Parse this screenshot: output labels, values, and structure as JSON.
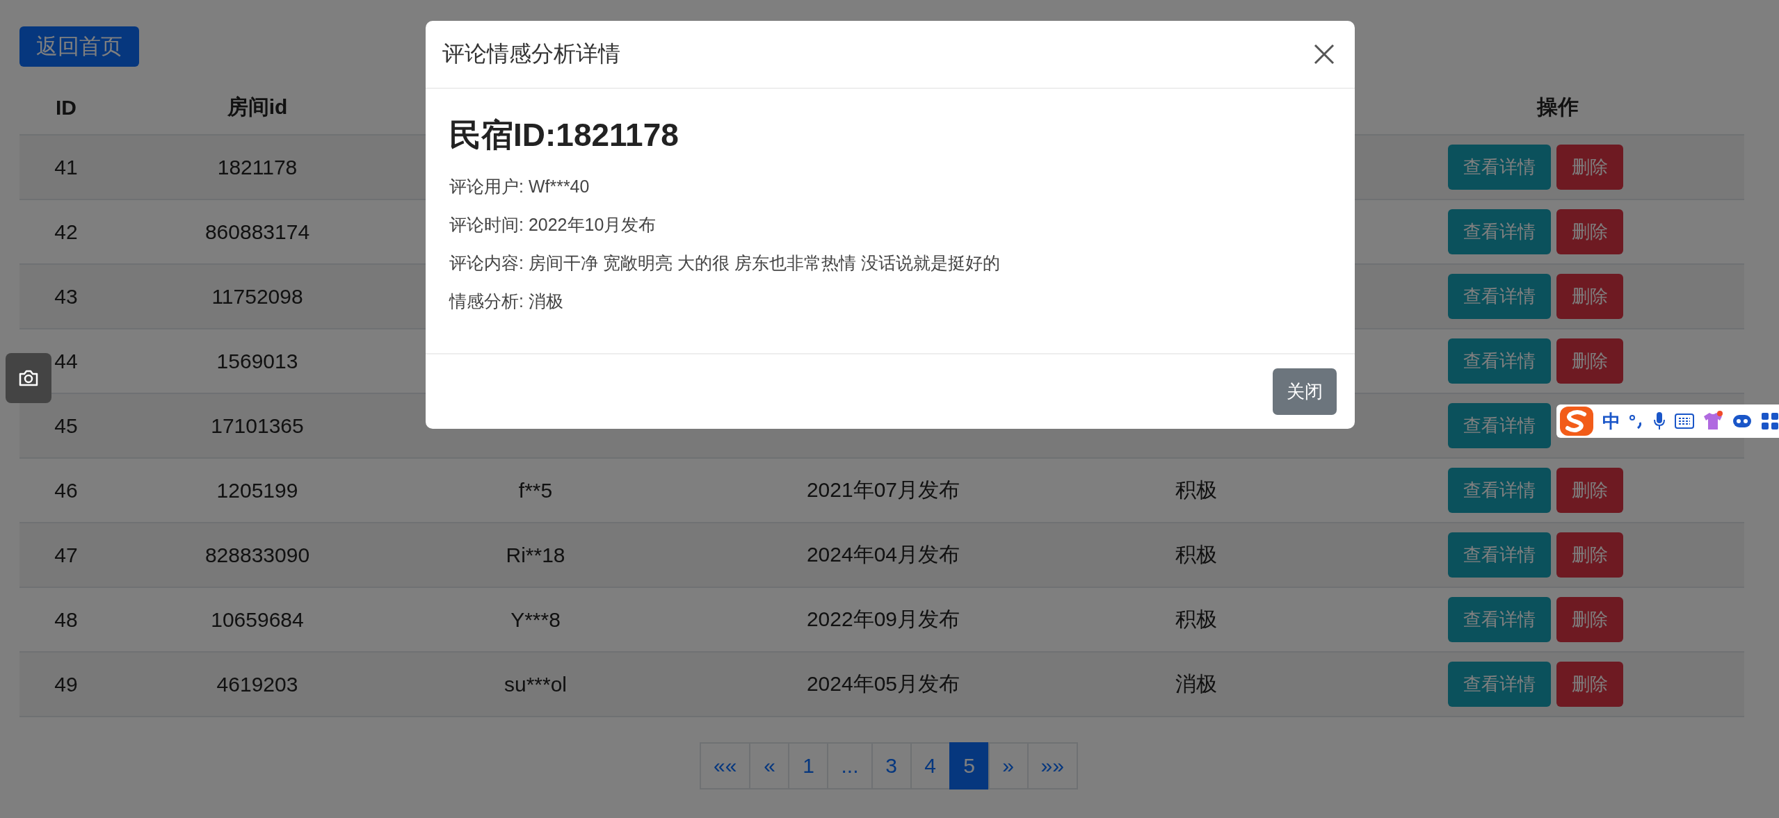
{
  "back_button": "返回首页",
  "table": {
    "columns": {
      "column_1": "ID",
      "column_2": "房间id",
      "column_6": "操作"
    },
    "rows": [
      {
        "id": "41",
        "room_id": "1821178",
        "actions": [
          "查看详情",
          "删除"
        ]
      },
      {
        "id": "42",
        "room_id": "860883174",
        "actions": [
          "查看详情",
          "删除"
        ]
      },
      {
        "id": "43",
        "room_id": "11752098",
        "actions": [
          "查看详情",
          "删除"
        ]
      },
      {
        "id": "44",
        "room_id": "1569013",
        "actions": [
          "查看详情",
          "删除"
        ]
      },
      {
        "id": "45",
        "room_id": "17101365",
        "actions": [
          "查看详情"
        ]
      },
      {
        "id": "46",
        "room_id": "1205199",
        "user": "f**5",
        "time": "2021年07月发布",
        "sentiment": "积极",
        "actions": [
          "查看详情",
          "删除"
        ]
      },
      {
        "id": "47",
        "room_id": "828833090",
        "user": "Ri**18",
        "time": "2024年04月发布",
        "sentiment": "积极",
        "actions": [
          "查看详情",
          "删除"
        ]
      },
      {
        "id": "48",
        "room_id": "10659684",
        "user": "Y***8",
        "time": "2022年09月发布",
        "sentiment": "积极",
        "actions": [
          "查看详情",
          "删除"
        ]
      },
      {
        "id": "49",
        "room_id": "4619203",
        "user": "su***ol",
        "time": "2024年05月发布",
        "sentiment": "消极",
        "actions": [
          "查看详情",
          "删除"
        ]
      }
    ]
  },
  "pagination": [
    {
      "label": "««",
      "selected": false
    },
    {
      "label": "«",
      "selected": false
    },
    {
      "label": "1",
      "selected": false
    },
    {
      "label": "...",
      "selected": false
    },
    {
      "label": "3",
      "selected": false
    },
    {
      "label": "4",
      "selected": false
    },
    {
      "label": "5",
      "selected": true
    },
    {
      "label": "»",
      "selected": false
    },
    {
      "label": "»»",
      "selected": false
    }
  ],
  "modal": {
    "title": "评论情感分析详情",
    "heading": "民宿ID:1821178",
    "fields": [
      "评论用户: Wf***40",
      "评论时间: 2022年10月发布",
      "评论内容: 房间干净 宽敞明亮 大的很 房东也非常热情 没话说就是挺好的",
      "情感分析: 消极"
    ],
    "close_button": "关闭"
  },
  "ime_toolbar": {
    "mode": "中"
  }
}
